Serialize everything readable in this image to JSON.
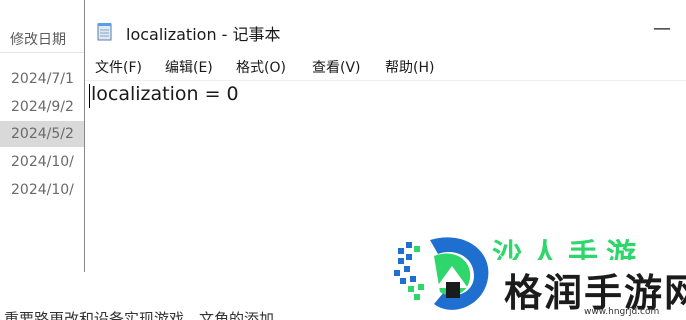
{
  "explorer": {
    "column_header": "修改日期",
    "rows": [
      "2024/7/1",
      "2024/9/2",
      "2024/5/2",
      "2024/10/",
      "2024/10/"
    ],
    "selected_index": 2
  },
  "notepad": {
    "title": "localization - 记事本",
    "minimize_glyph": "—",
    "menu": {
      "file": "文件(F)",
      "edit": "编辑(E)",
      "format": "格式(O)",
      "view": "查看(V)",
      "help": "帮助(H)"
    },
    "content": "localization = 0"
  },
  "caption": "重要路更改和设备实现游戏，文角的添加",
  "watermark": {
    "brand_main": "格润手游网",
    "brand_top": "沙人手游",
    "url": "www.hngrjd.com",
    "colors": {
      "green": "#2fd66b",
      "blue": "#1e6fd0",
      "dark": "#1b1b1b"
    }
  }
}
